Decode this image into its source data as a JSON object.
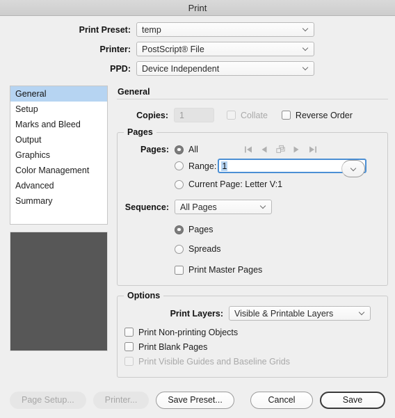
{
  "window": {
    "title": "Print"
  },
  "topform": {
    "rows": [
      {
        "label": "Print Preset:",
        "value": "temp"
      },
      {
        "label": "Printer:",
        "value": "PostScript® File"
      },
      {
        "label": "PPD:",
        "value": "Device Independent"
      }
    ]
  },
  "sidebar": {
    "items": [
      {
        "label": "General",
        "selected": true
      },
      {
        "label": "Setup",
        "selected": false
      },
      {
        "label": "Marks and Bleed",
        "selected": false
      },
      {
        "label": "Output",
        "selected": false
      },
      {
        "label": "Graphics",
        "selected": false
      },
      {
        "label": "Color Management",
        "selected": false
      },
      {
        "label": "Advanced",
        "selected": false
      },
      {
        "label": "Summary",
        "selected": false
      }
    ]
  },
  "pane": {
    "title": "General",
    "copies": {
      "label": "Copies:",
      "value": "1",
      "collate_label": "Collate",
      "reverse_order_label": "Reverse Order"
    },
    "pages_group": {
      "legend": "Pages",
      "pages_label": "Pages:",
      "option_all": "All",
      "option_range": "Range:",
      "range_value": "1",
      "option_current_page": "Current Page: Letter V:1",
      "sequence_label": "Sequence:",
      "sequence_value": "All Pages",
      "option_pages": "Pages",
      "option_spreads": "Spreads",
      "print_master_pages_label": "Print Master Pages",
      "nav_icons": [
        "first-page-icon",
        "previous-page-icon",
        "pages-stack-icon",
        "next-page-icon",
        "last-page-icon"
      ]
    },
    "options_group": {
      "legend": "Options",
      "print_layers_label": "Print Layers:",
      "print_layers_value": "Visible & Printable Layers",
      "print_non_printing_label": "Print Non-printing Objects",
      "print_blank_pages_label": "Print Blank Pages",
      "print_visible_guides_label": "Print Visible Guides and Baseline Grids"
    }
  },
  "footer": {
    "page_setup": "Page Setup...",
    "printer": "Printer...",
    "save_preset": "Save Preset...",
    "cancel": "Cancel",
    "save": "Save"
  },
  "colors": {
    "selection": "#b6d4f2",
    "focus_ring": "#4b8fd4",
    "preview_page": "#575757",
    "window_bg": "#efefef"
  }
}
